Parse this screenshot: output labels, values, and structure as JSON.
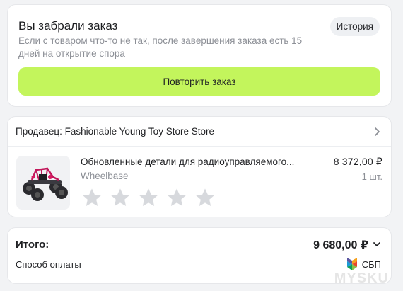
{
  "status_card": {
    "title": "Вы забрали заказ",
    "history_button": "История",
    "description": "Если с товаром что-то не так, после завершения заказа есть 15 дней на открытие спора",
    "repeat_button": "Повторить заказ"
  },
  "order_card": {
    "seller": "Продавец: Fashionable Young Toy Store Store",
    "product": {
      "name": "Обновленные детали для радиоуправляемого...",
      "variant": "Wheelbase",
      "price": "8 372,00 ₽",
      "quantity": "1 шт.",
      "rating_stars": 5,
      "rating_value": 0
    }
  },
  "total_card": {
    "total_label": "Итого:",
    "total_value": "9 680,00 ₽",
    "payment_label": "Способ оплаты",
    "payment_method": "СБП"
  },
  "watermark": "MYSKU",
  "colors": {
    "accent": "#c3f55c",
    "background": "#f2f3f5",
    "muted_text": "#8c8f96",
    "star_empty": "#d7d9dd"
  }
}
